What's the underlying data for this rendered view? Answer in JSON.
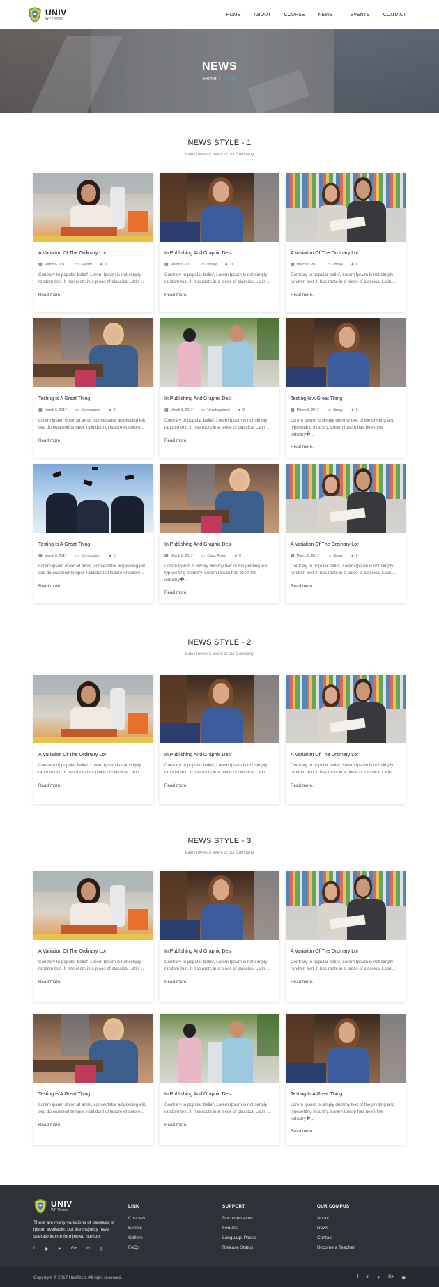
{
  "site": {
    "name": "UNIV",
    "tagline": "WP Theme"
  },
  "nav": [
    {
      "label": "HOME"
    },
    {
      "label": "ABOUT"
    },
    {
      "label": "COURSE"
    },
    {
      "label": "NEWS",
      "dropdown": true
    },
    {
      "label": "EVENTS"
    },
    {
      "label": "CONTACT"
    }
  ],
  "hero": {
    "title": "NEWS",
    "crumb_home": "Home",
    "crumb_sep": "/",
    "crumb_current": "News"
  },
  "styles": [
    {
      "title": "NEWS STYLE - 1",
      "subtitle": "Latest news & event of our Company"
    },
    {
      "title": "NEWS STYLE - 2",
      "subtitle": "Latest news & event of our Company"
    },
    {
      "title": "NEWS STYLE - 3",
      "subtitle": "Latest news & event of our Company"
    }
  ],
  "style1_cards": [
    {
      "title": "A Variation Of The Ordinary Lor",
      "date": "March 6, 2017",
      "category": "Facility",
      "comments": "0",
      "excerpt": "Contrary to popular belief, Lorem Ipsum is not simply random text. It has roots in a piece of classical Latin ...",
      "read_more": "Read more."
    },
    {
      "title": "In Publishing And Graphic Desi",
      "date": "March 6, 2017",
      "category": "library",
      "comments": "11",
      "excerpt": "Contrary to popular belief, Lorem Ipsum is not simply random text. It has roots in a piece of classical Latin ...",
      "read_more": "Read more."
    },
    {
      "title": "A Variation Of The Ordinary Lor",
      "date": "March 6, 2017",
      "category": "library",
      "comments": "0",
      "excerpt": "Contrary to popular belief, Lorem Ipsum is not simply random text. It has roots in a piece of classical Latin ...",
      "read_more": "Read more."
    },
    {
      "title": "Testing Is A Great Thing",
      "date": "March 6, 2017",
      "category": "Convocation",
      "comments": "0",
      "excerpt": "Lorem ipsum dolor sit amet, consectetur adipisicing elit, sed do eiusmod tempor incididunt ut labore et dolore...",
      "read_more": "Read more."
    },
    {
      "title": "In Publishing And Graphic Desi",
      "date": "March 6, 2017",
      "category": "Uncategorized",
      "comments": "0",
      "excerpt": "Contrary to popular belief, Lorem Ipsum is not simply random text. It has roots in a piece of classical Latin ...",
      "read_more": "Read more."
    },
    {
      "title": "Testing Is A Great Thing",
      "date": "March 6, 2017",
      "category": "library",
      "comments": "0",
      "excerpt": "Lorem Ipsum is simply dummy text of the printing and typesetting industry. Lorem Ipsum has been the industry�...",
      "read_more": "Read more."
    },
    {
      "title": "Testing Is A Great Thing",
      "date": "March 6, 2017",
      "category": "Convocation",
      "comments": "0",
      "excerpt": "Lorem ipsum dolor sit amet, consectetur adipisicing elit, sed do eiusmod tempor incididunt ut labore et dolore...",
      "read_more": "Read more."
    },
    {
      "title": "In Publishing And Graphic Desi",
      "date": "March 6, 2017",
      "category": "Class Room",
      "comments": "0",
      "excerpt": "Lorem Ipsum is simply dummy text of the printing and typesetting industry. Lorem Ipsum has been the industry�...",
      "read_more": "Read more."
    },
    {
      "title": "A Variation Of The Ordinary Lor",
      "date": "March 6, 2017",
      "category": "library",
      "comments": "0",
      "excerpt": "Contrary to popular belief, Lorem Ipsum is not simply random text. It has roots in a piece of classical Latin ...",
      "read_more": "Read more."
    }
  ],
  "style2_cards": [
    {
      "title": "A Variation Of The Ordinary Lor",
      "excerpt": "Contrary to popular belief, Lorem Ipsum is not simply random text. It has roots in a piece of classical Latin ...",
      "read_more": "Read more."
    },
    {
      "title": "In Publishing And Graphic Desi",
      "excerpt": "Contrary to popular belief, Lorem Ipsum is not simply random text. It has roots in a piece of classical Latin ...",
      "read_more": "Read more."
    },
    {
      "title": "A Variation Of The Ordinary Lor",
      "excerpt": "Contrary to popular belief, Lorem Ipsum is not simply random text. It has roots in a piece of classical Latin ...",
      "read_more": "Read more."
    }
  ],
  "style3_cards": [
    {
      "title": "A Variation Of The Ordinary Lor",
      "excerpt": "Contrary to popular belief, Lorem Ipsum is not simply random text. It has roots in a piece of classical Latin ...",
      "read_more": "Read more."
    },
    {
      "title": "In Publishing And Graphic Desi",
      "excerpt": "Contrary to popular belief, Lorem Ipsum is not simply random text. It has roots in a piece of classical Latin ...",
      "read_more": "Read more."
    },
    {
      "title": "A Variation Of The Ordinary Lor",
      "excerpt": "Contrary to popular belief, Lorem Ipsum is not simply random text. It has roots in a piece of classical Latin ...",
      "read_more": "Read more."
    },
    {
      "title": "Testing Is A Great Thing",
      "excerpt": "Lorem ipsum dolor sit amet, consectetur adipisicing elit, sed do eiusmod tempor incididunt ut labore et dolore...",
      "read_more": "Read more."
    },
    {
      "title": "In Publishing And Graphic Desi",
      "excerpt": "Contrary to popular belief, Lorem Ipsum is not simply random text. It has roots in a piece of classical Latin ...",
      "read_more": "Read more."
    },
    {
      "title": "Testing Is A Great Thing",
      "excerpt": "Lorem Ipsum is simply dummy text of the printing and typesetting industry. Lorem Ipsum has been the industry�...",
      "read_more": "Read more."
    }
  ],
  "footer": {
    "about": "There are many variations of passaes of lpsum available, but the majority have suerato inome formjected humour",
    "link_head": "LINK",
    "links": [
      "Courses",
      "Events",
      "Gallery",
      "FAQs"
    ],
    "support_head": "SUPPORT",
    "support": [
      "Documentation",
      "Forums",
      "Language Packs",
      "Release Status"
    ],
    "campus_head": "OUR COMPUS",
    "campus": [
      "About",
      "News",
      "Contact",
      "Become a Teacher"
    ],
    "socials": [
      "f",
      "rss",
      "tw",
      "G+",
      "p",
      "ig"
    ],
    "copyright": "Copyright © 2017 HasTech. All right reserved.",
    "bottom_socials": [
      "f",
      "in",
      "tw",
      "G+",
      "yt"
    ]
  },
  "colors": {
    "accent": "#3bb0d6",
    "footer_bg": "#2e3238",
    "bottom_bg": "#262a30"
  }
}
